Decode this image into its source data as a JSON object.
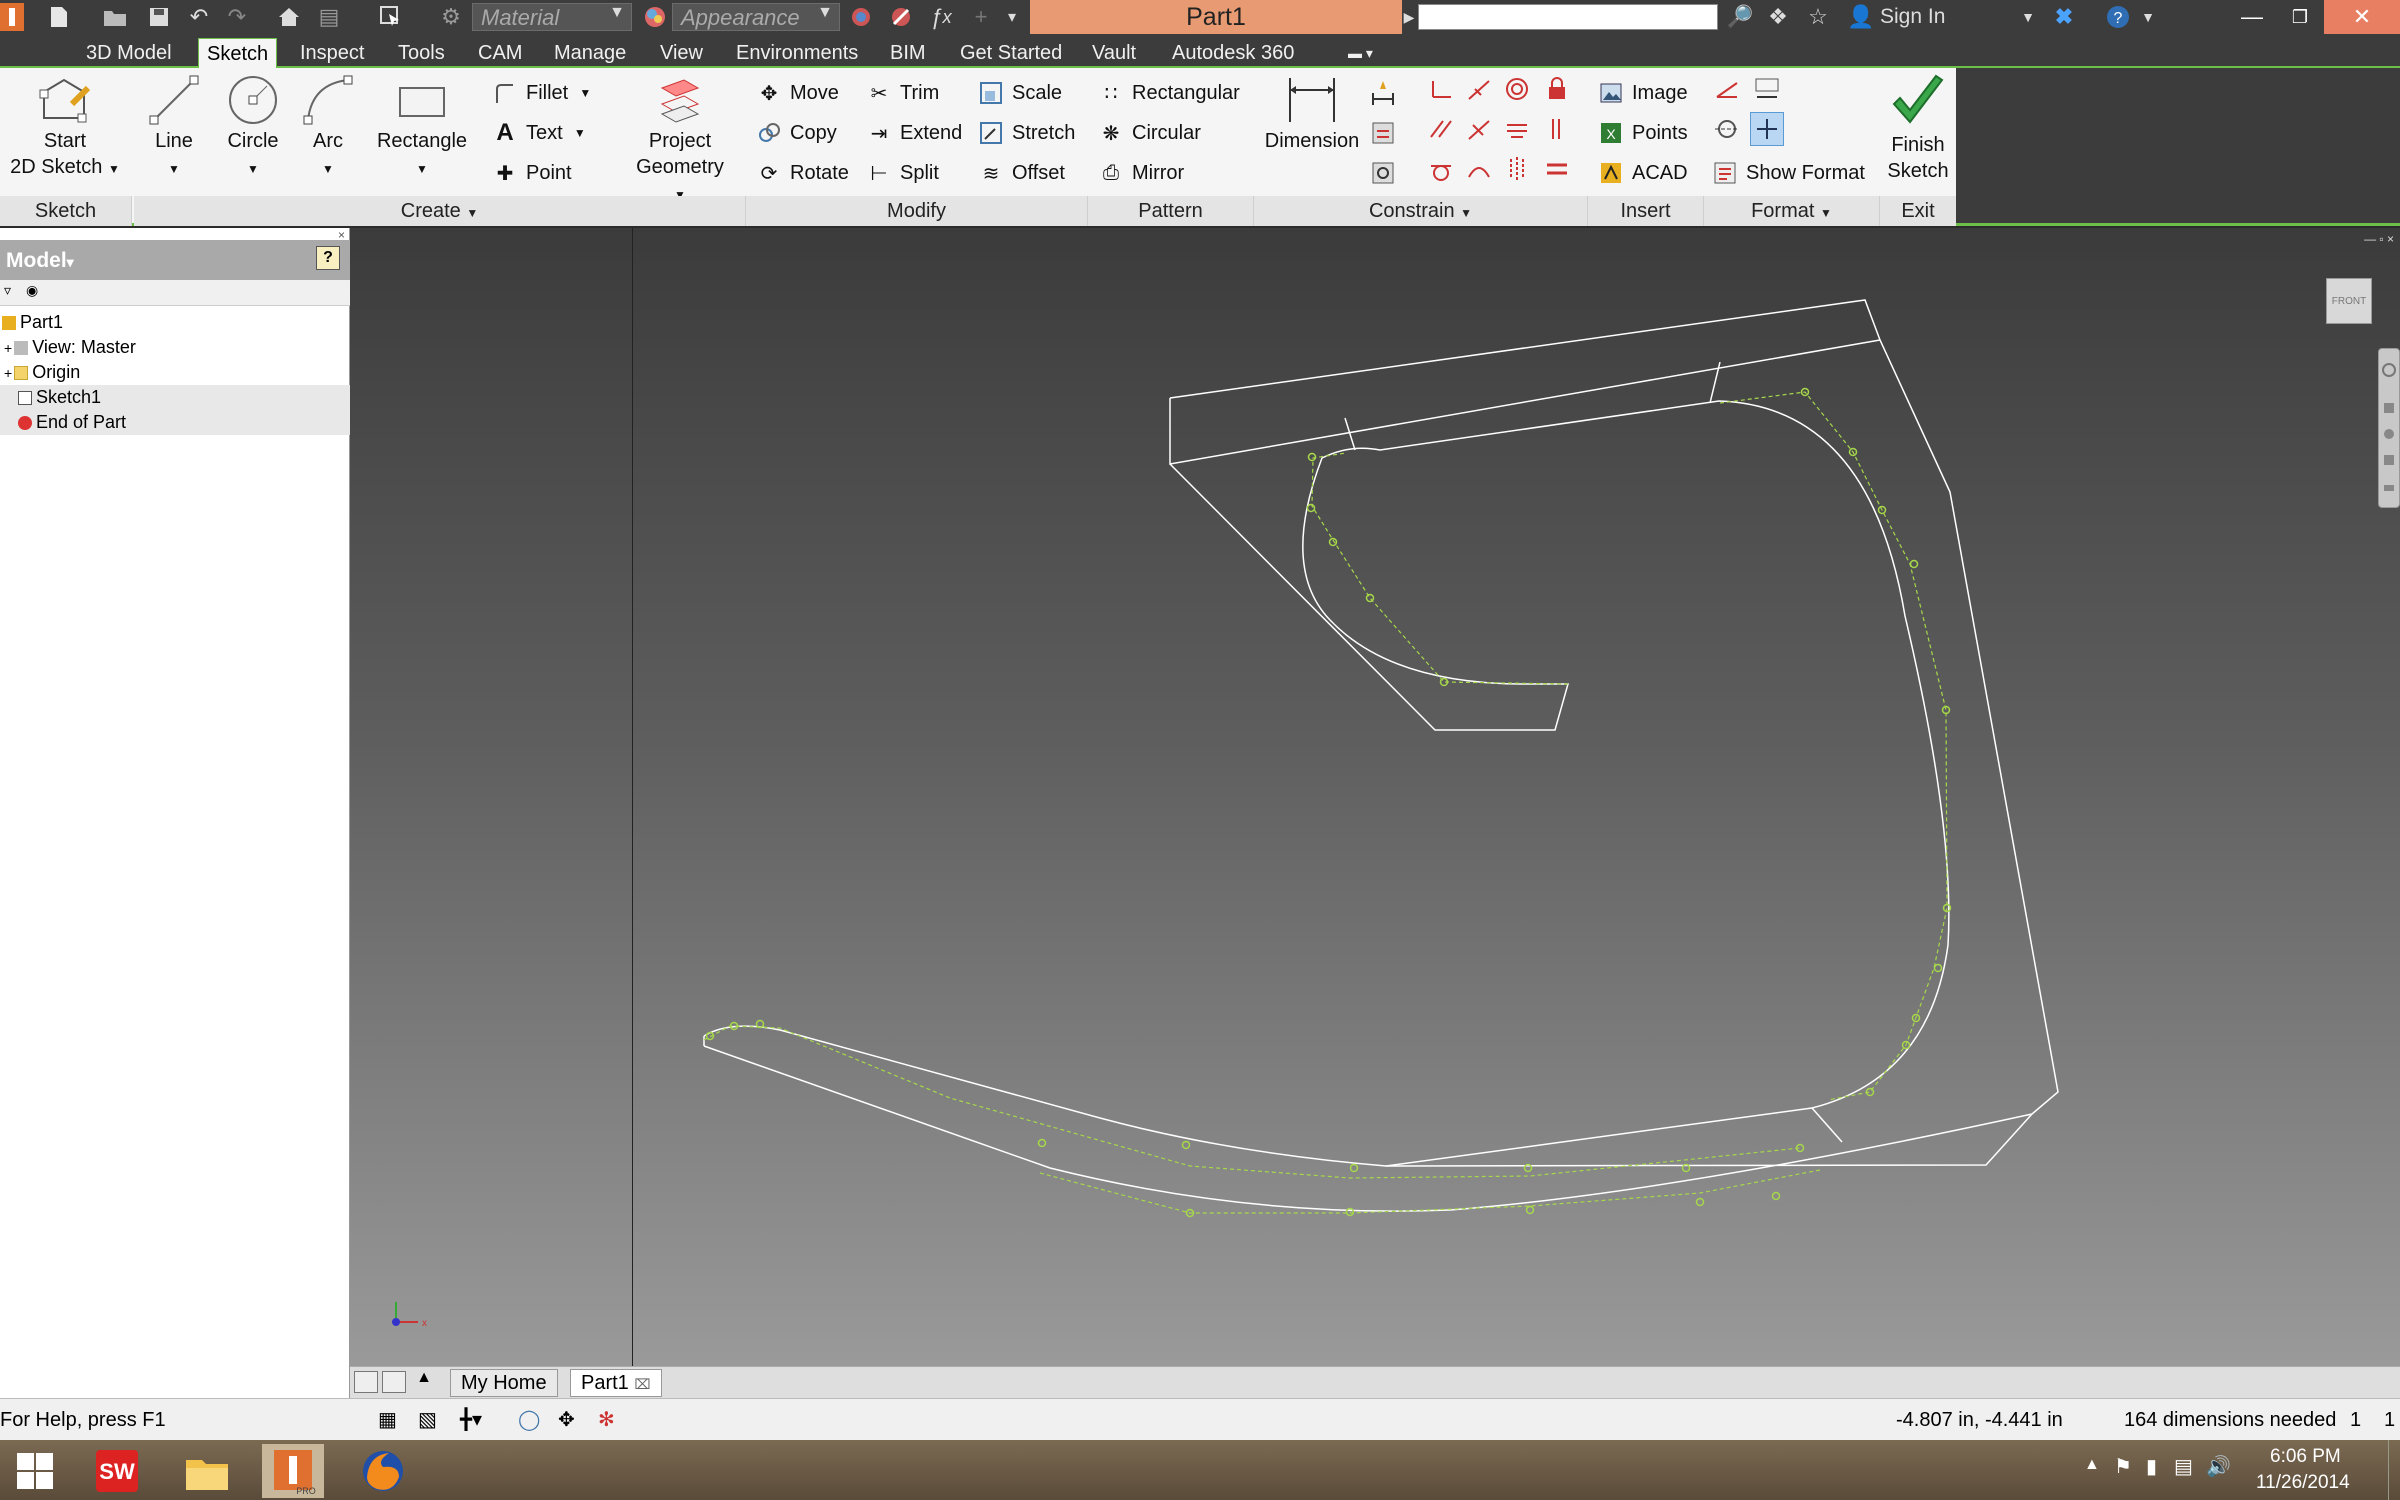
{
  "titlebar": {
    "material": "Material",
    "appearance": "Appearance",
    "doc_title": "Part1",
    "sign_in": "Sign In"
  },
  "tabs": [
    "3D Model",
    "Sketch",
    "Inspect",
    "Tools",
    "CAM",
    "Manage",
    "View",
    "Environments",
    "BIM",
    "Get Started",
    "Vault",
    "Autodesk 360"
  ],
  "active_tab": "Sketch",
  "ribbon": {
    "sketch_panel": {
      "start_line1": "Start",
      "start_line2": "2D Sketch",
      "label": "Sketch"
    },
    "create_panel": {
      "line": "Line",
      "circle": "Circle",
      "arc": "Arc",
      "rectangle": "Rectangle",
      "fillet": "Fillet",
      "text": "Text",
      "point": "Point",
      "project_line1": "Project",
      "project_line2": "Geometry",
      "label": "Create"
    },
    "modify_panel": {
      "move": "Move",
      "copy": "Copy",
      "rotate": "Rotate",
      "trim": "Trim",
      "extend": "Extend",
      "split": "Split",
      "scale": "Scale",
      "stretch": "Stretch",
      "offset": "Offset",
      "label": "Modify"
    },
    "pattern_panel": {
      "rectangular": "Rectangular",
      "circular": "Circular",
      "mirror": "Mirror",
      "label": "Pattern"
    },
    "constrain_panel": {
      "dimension": "Dimension",
      "label": "Constrain"
    },
    "insert_panel": {
      "image": "Image",
      "points": "Points",
      "acad": "ACAD",
      "label": "Insert"
    },
    "format_panel": {
      "show_format": "Show Format",
      "label": "Format"
    },
    "exit_panel": {
      "finish_line1": "Finish",
      "finish_line2": "Sketch",
      "label": "Exit"
    }
  },
  "browser": {
    "title": "Model",
    "help": "?",
    "tree": [
      "Part1",
      "View: Master",
      "Origin",
      "Sketch1",
      "End of Part"
    ]
  },
  "viewcube_label": "FRONT",
  "doc_tabs": [
    "My Home",
    "Part1"
  ],
  "status": {
    "help_text": "For Help, press F1",
    "coordinates": "-4.807 in, -4.441 in",
    "dimensions_needed": "164 dimensions needed",
    "count_a": "1",
    "count_b": "1"
  },
  "taskbar": {
    "time": "6:06 PM",
    "date": "11/26/2014",
    "inventor_badge": "PRO"
  },
  "colors": {
    "accent_green": "#6cc04a",
    "title_orange": "#e89b72",
    "sketch_line": "#ffffff",
    "spline_green": "#a6d84a"
  }
}
